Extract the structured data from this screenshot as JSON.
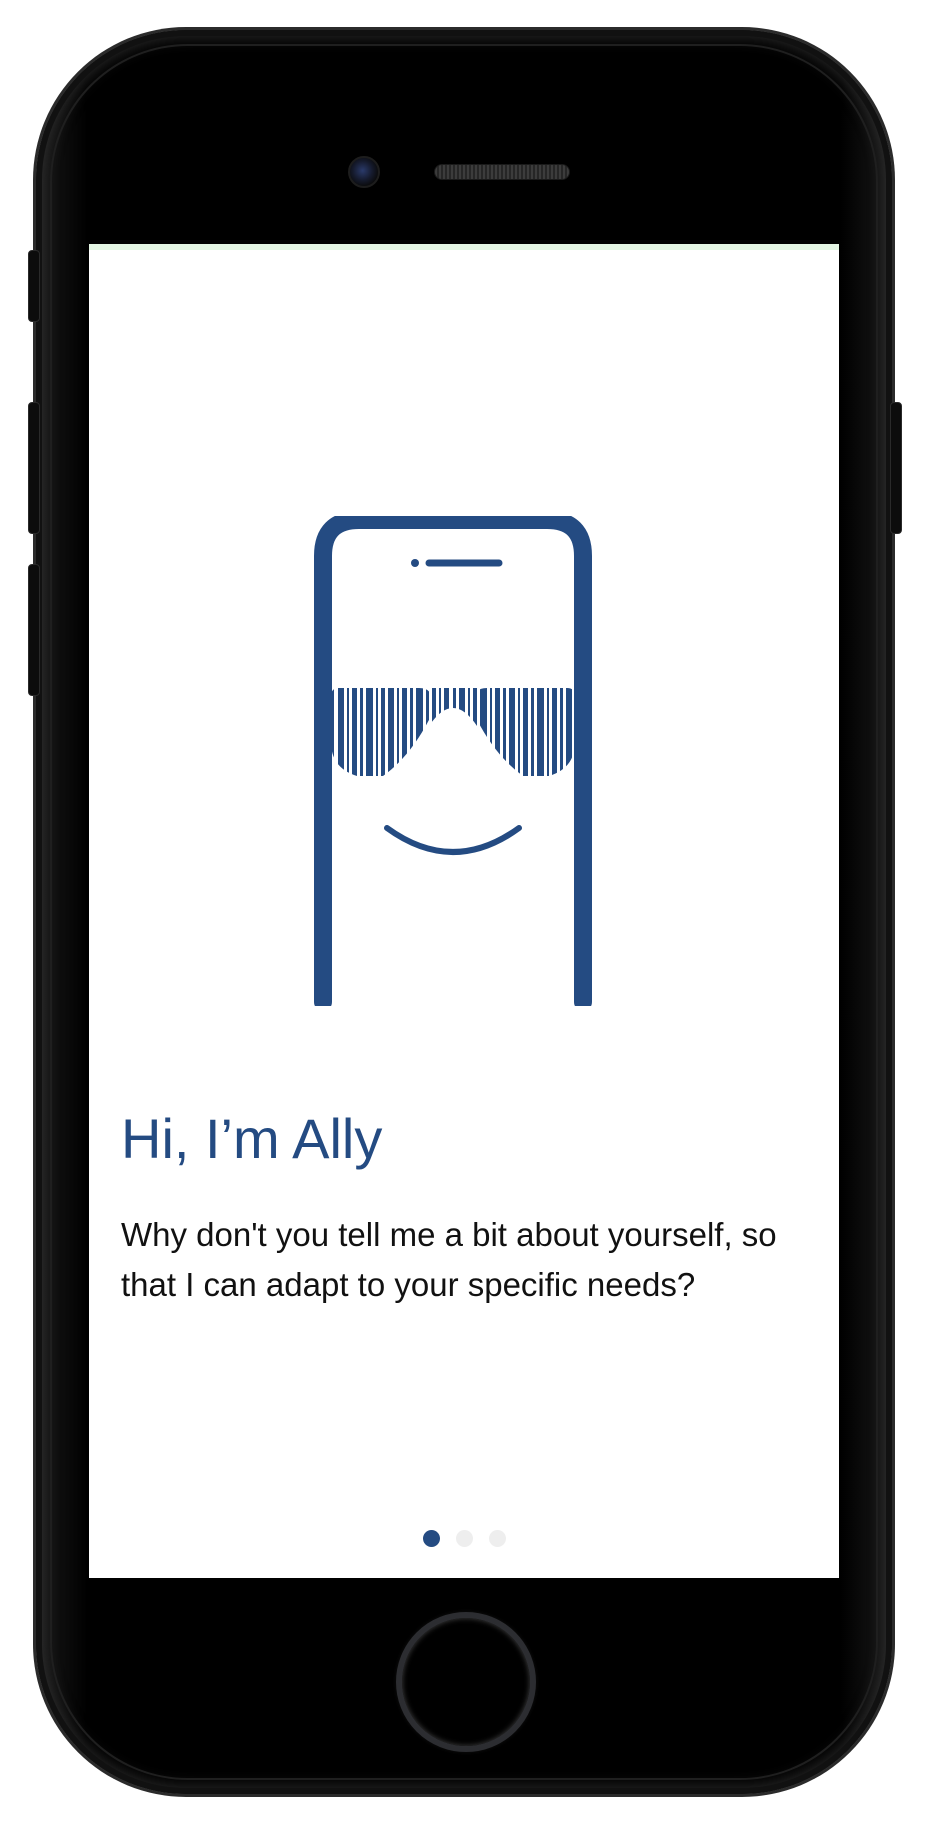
{
  "onboarding": {
    "title": "Hi, I’m Ally",
    "message": "Why don't you tell me a bit about yourself, so that I can adapt to your specific needs?",
    "pagination": {
      "total_pages": 3,
      "current_page": 1
    }
  },
  "illustration": {
    "icon": "ally-mascot-phone-icon",
    "color": "#244b82"
  },
  "colors": {
    "accent": "#244b82",
    "text": "#111111",
    "inactive_dot": "#eeeeee",
    "status_strip": "#e3f5e3"
  }
}
